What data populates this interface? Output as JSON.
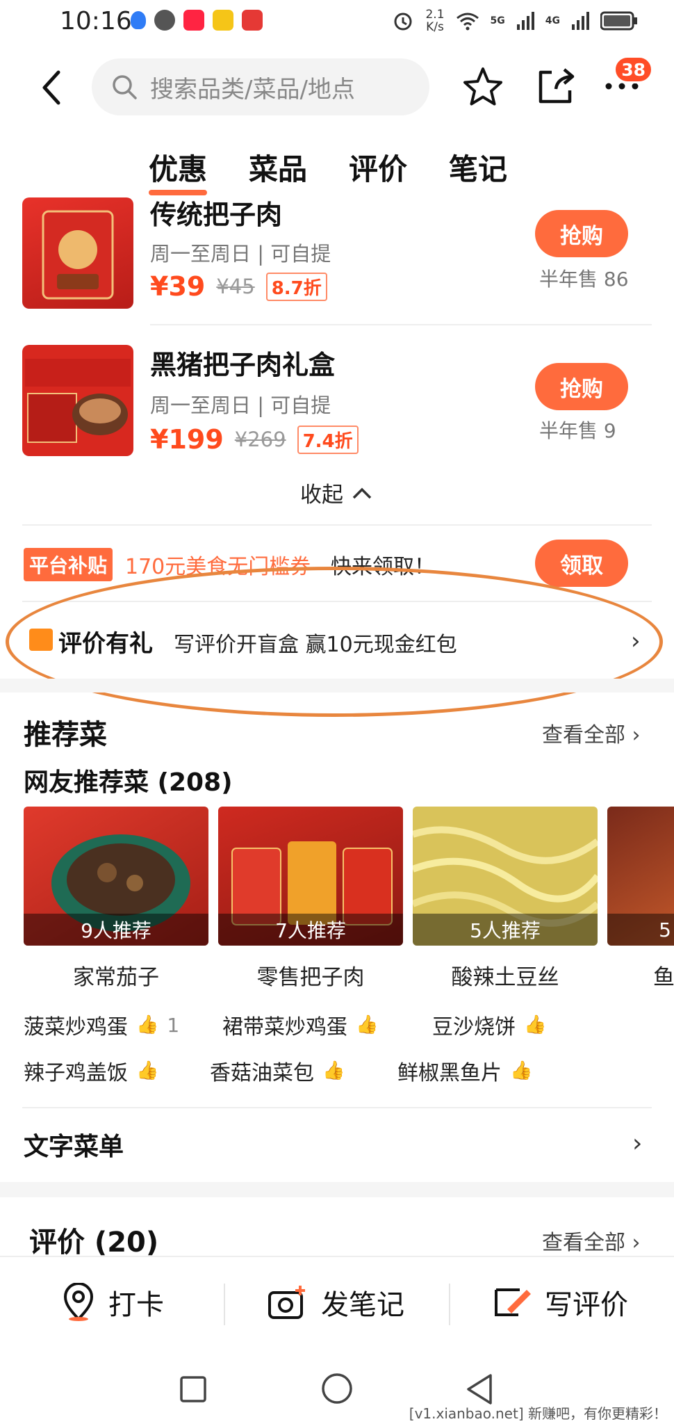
{
  "status_bar": {
    "time": "10:16",
    "net_speed": "2.1",
    "net_unit": "K/s",
    "sig1": "5G",
    "sig2": "4G"
  },
  "search": {
    "placeholder": "搜索品类/菜品/地点"
  },
  "badge_count": "38",
  "tabs": [
    "优惠",
    "菜品",
    "评价",
    "笔记"
  ],
  "deals": [
    {
      "title": "传统把子肉",
      "sub": "周一至周日 | 可自提",
      "price": "¥39",
      "old_price": "¥45",
      "discount": "8.7折",
      "button": "抢购",
      "sold": "半年售 86"
    },
    {
      "title": "黑猪把子肉礼盒",
      "sub": "周一至周日 | 可自提",
      "price": "¥199",
      "old_price": "¥269",
      "discount": "7.4折",
      "button": "抢购",
      "sold": "半年售 9"
    }
  ],
  "collapse_label": "收起",
  "subsidy": {
    "tag": "平台补贴",
    "text": "170元美食无门槛券",
    "text2": "快来领取！",
    "button": "领取"
  },
  "reward": {
    "title": "评价有礼",
    "text": "写评价开盲盒 赢10元现金红包"
  },
  "recommended": {
    "title": "推荐菜",
    "see_all": "查看全部",
    "subtitle": "网友推荐菜 (208)",
    "dishes": [
      {
        "name": "家常茄子",
        "recs": "9人推荐"
      },
      {
        "name": "零售把子肉",
        "recs": "7人推荐"
      },
      {
        "name": "酸辣土豆丝",
        "recs": "5人推荐"
      },
      {
        "name": "鱼",
        "recs": "5"
      }
    ],
    "more": [
      {
        "name": "菠菜炒鸡蛋",
        "likes": "1"
      },
      {
        "name": "裙带菜炒鸡蛋",
        "likes": ""
      },
      {
        "name": "豆沙烧饼",
        "likes": ""
      },
      {
        "name": "辣子鸡盖饭",
        "likes": ""
      },
      {
        "name": "香菇油菜包",
        "likes": ""
      },
      {
        "name": "鲜椒黑鱼片",
        "likes": ""
      }
    ]
  },
  "text_menu": "文字菜单",
  "reviews": {
    "title": "评价 (20)",
    "see_all": "查看全部"
  },
  "actions": [
    "打卡",
    "发笔记",
    "写评价"
  ],
  "watermark": "[v1.xianbao.net] 新赚吧，有你更精彩！",
  "colors": {
    "accent": "#ff6b3d",
    "price": "#ff4a1d",
    "highlight_ellipse": "#e8863e"
  }
}
